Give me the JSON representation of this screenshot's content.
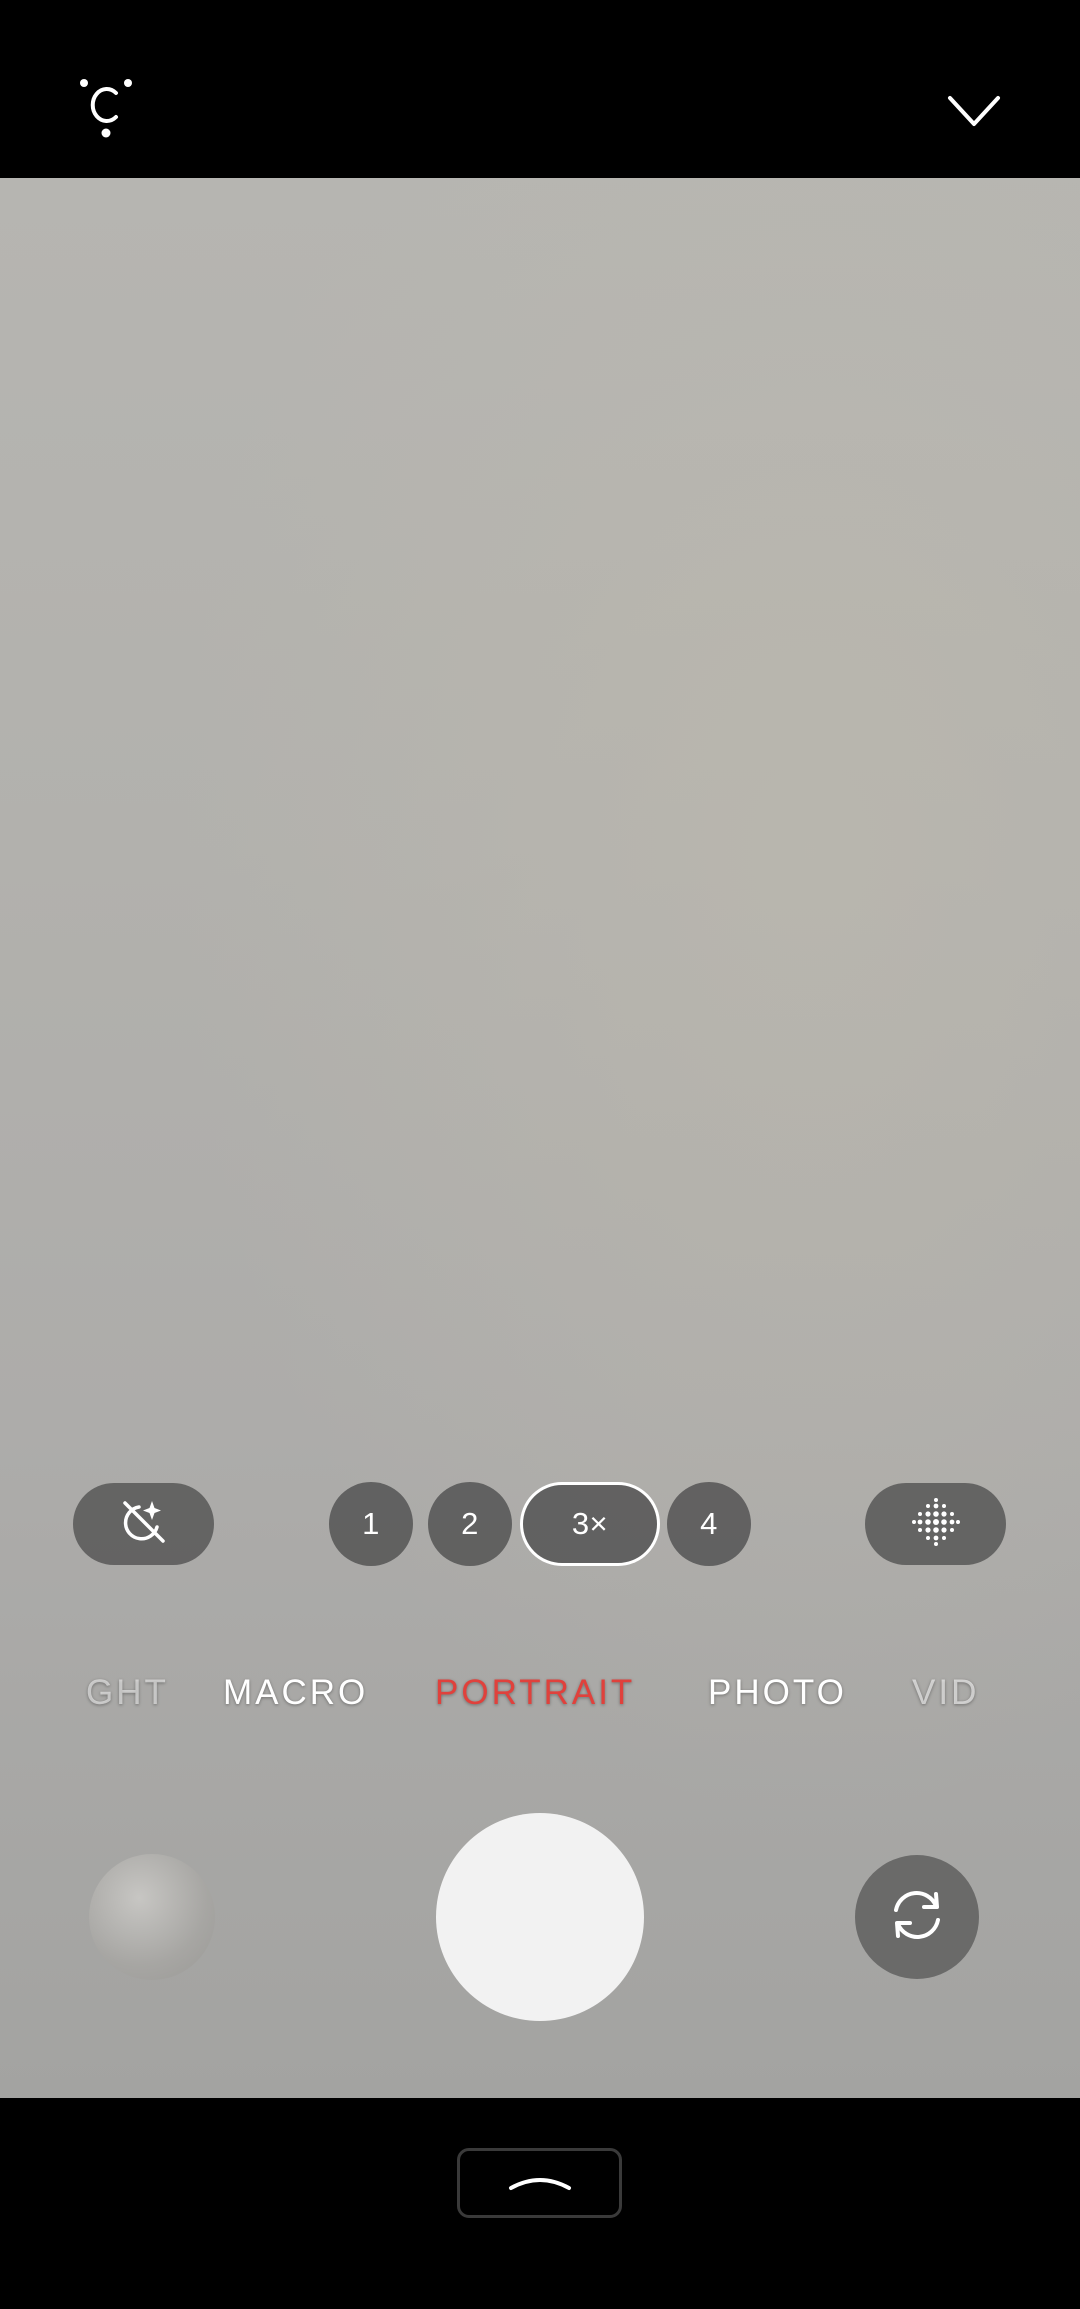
{
  "top_bar": {
    "left_icon": "ai-camera-icon",
    "right_icon": "chevron-down-icon"
  },
  "controls": {
    "left_icon": "auto-enhance-off-icon",
    "right_icon": "filter-dots-icon",
    "zoom_levels": [
      "1",
      "2",
      "3×",
      "4"
    ],
    "selected_zoom": "3×"
  },
  "modes": [
    "GHT",
    "MACRO",
    "PORTRAIT",
    "PHOTO",
    "VID"
  ],
  "selected_mode": "PORTRAIT",
  "accent_color": "#e0413c",
  "capture": {
    "gallery_icon": "gallery-thumbnail",
    "shutter_icon": "shutter-button",
    "flip_icon": "switch-camera-icon"
  },
  "nav": {
    "handle_icon": "chevron-up-icon"
  }
}
